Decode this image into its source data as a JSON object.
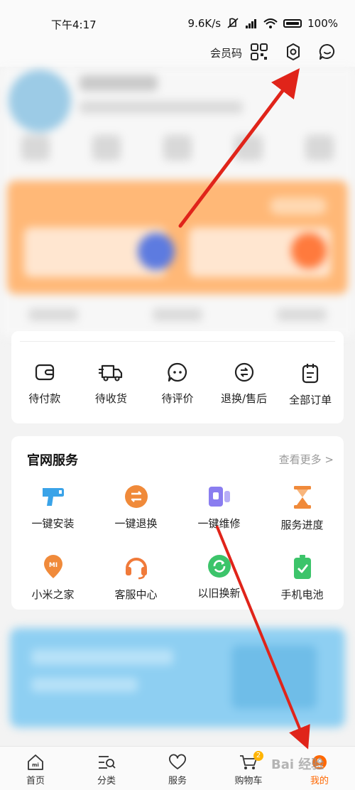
{
  "status_bar": {
    "time": "下午4:17",
    "speed": "9.6K/s",
    "battery": "100%"
  },
  "top_bar": {
    "member_code_label": "会员码"
  },
  "orders": [
    {
      "label": "待付款",
      "icon": "wallet-icon"
    },
    {
      "label": "待收货",
      "icon": "truck-icon"
    },
    {
      "label": "待评价",
      "icon": "comment-icon"
    },
    {
      "label": "退换/售后",
      "icon": "refund-icon"
    },
    {
      "label": "全部订单",
      "icon": "clipboard-icon"
    }
  ],
  "services": {
    "title": "官网服务",
    "more_label": "查看更多 >",
    "items": [
      {
        "label": "一键安装",
        "icon": "drill-icon",
        "color": "#3aa3e8"
      },
      {
        "label": "一键退换",
        "icon": "exchange-icon",
        "color": "#f08a3a"
      },
      {
        "label": "一键维修",
        "icon": "repair-icon",
        "color": "#8a7df0"
      },
      {
        "label": "服务进度",
        "icon": "hourglass-icon",
        "color": "#f08a3a"
      },
      {
        "label": "小米之家",
        "icon": "mi-home-icon",
        "color": "#f08a3a"
      },
      {
        "label": "客服中心",
        "icon": "headset-icon",
        "color": "#f07a3a"
      },
      {
        "label": "以旧换新",
        "icon": "recycle-icon",
        "color": "#3cc46a"
      },
      {
        "label": "手机电池",
        "icon": "battery-icon",
        "color": "#3cc46a"
      }
    ]
  },
  "nav": [
    {
      "label": "首页",
      "icon": "home-icon"
    },
    {
      "label": "分类",
      "icon": "category-icon"
    },
    {
      "label": "服务",
      "icon": "heart-icon"
    },
    {
      "label": "购物车",
      "icon": "cart-icon",
      "badge": "2"
    },
    {
      "label": "我的",
      "icon": "profile-icon"
    }
  ],
  "watermark": "Bai 经验",
  "accent_color": "#ff6700"
}
